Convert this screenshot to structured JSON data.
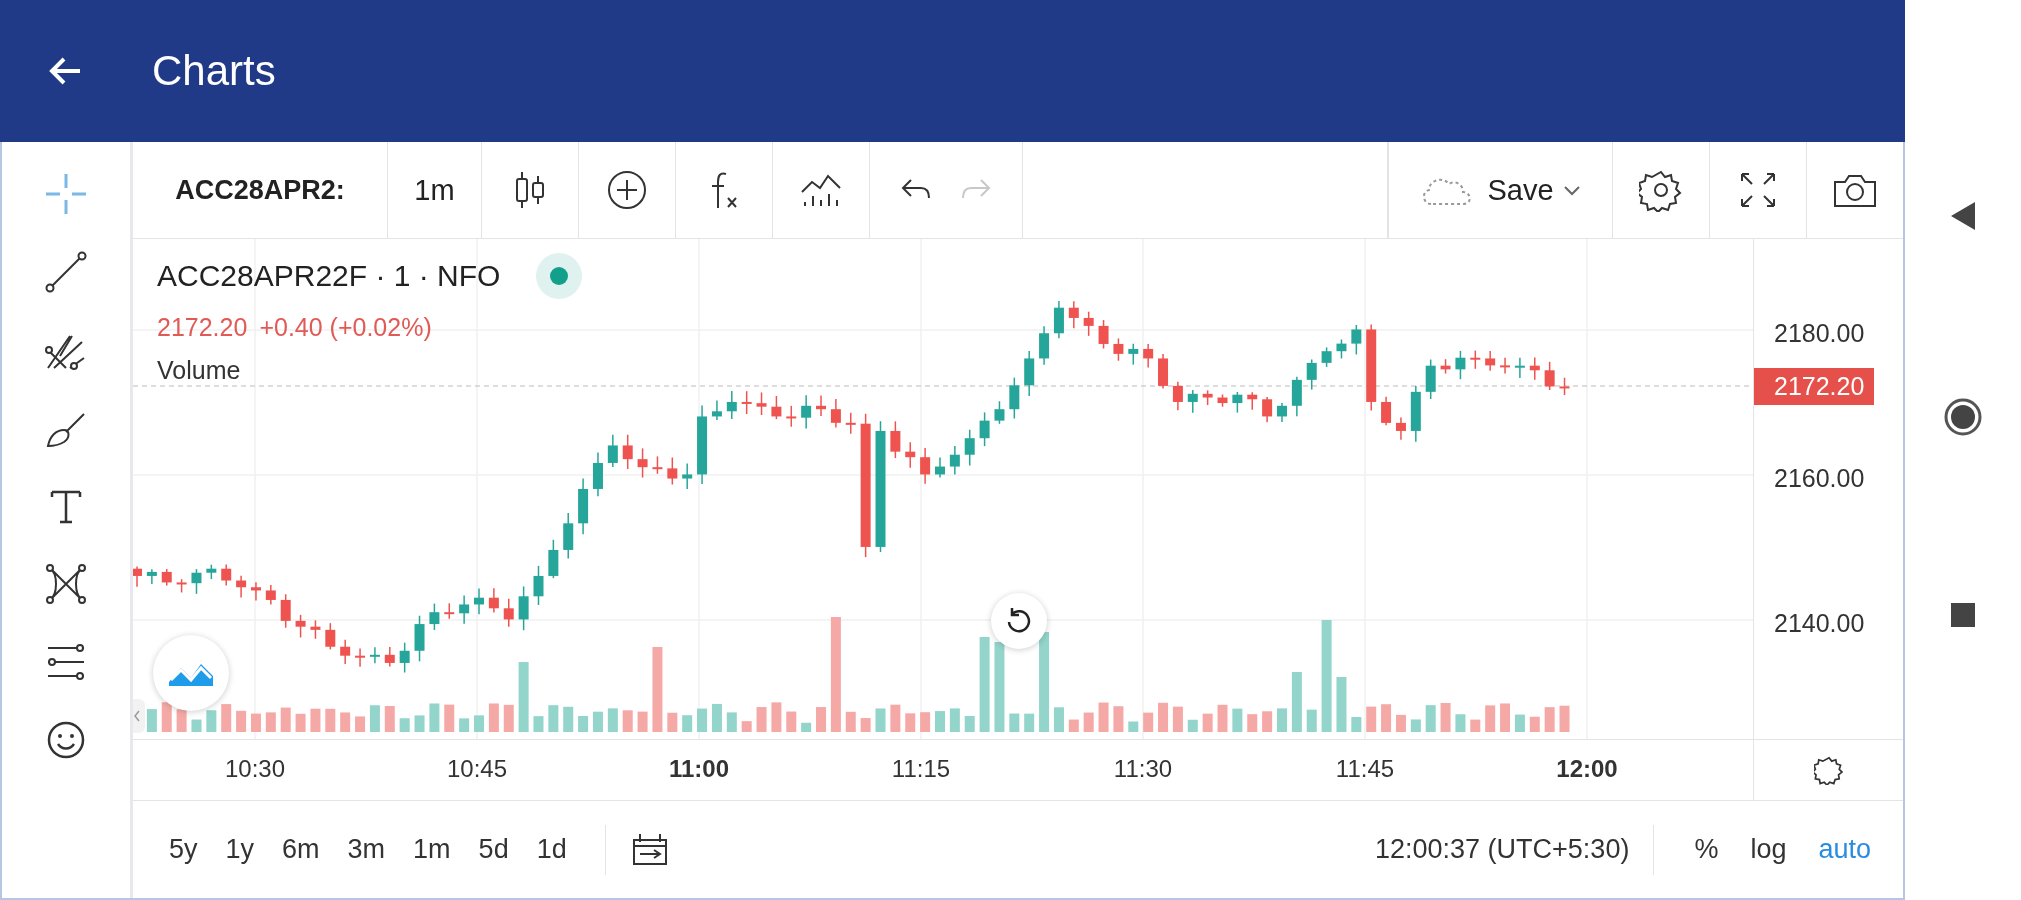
{
  "header": {
    "title": "Charts"
  },
  "toolbar": {
    "symbol": "ACC28APR2:",
    "interval": "1m",
    "save_label": "Save",
    "redo_disabled": true
  },
  "legend": {
    "title": "ACC28APR22F · 1 · NFO",
    "market_open": true,
    "price": "2172.20",
    "change": "+0.40 (+0.02%)",
    "study": "Volume"
  },
  "price_axis": {
    "ticks": [
      "2180.00",
      "2160.00",
      "2140.00"
    ],
    "last_price": "2172.20"
  },
  "time_axis": [
    {
      "label": "10:30",
      "bold": false
    },
    {
      "label": "10:45",
      "bold": false
    },
    {
      "label": "11:00",
      "bold": true
    },
    {
      "label": "11:15",
      "bold": false
    },
    {
      "label": "11:30",
      "bold": false
    },
    {
      "label": "11:45",
      "bold": false
    },
    {
      "label": "12:00",
      "bold": true
    }
  ],
  "ranges": [
    "5y",
    "1y",
    "6m",
    "3m",
    "1m",
    "5d",
    "1d"
  ],
  "clock": "12:00:37 (UTC+5:30)",
  "scale_options": [
    {
      "label": "%",
      "selected": false
    },
    {
      "label": "log",
      "selected": false
    },
    {
      "label": "auto",
      "selected": true
    }
  ]
}
